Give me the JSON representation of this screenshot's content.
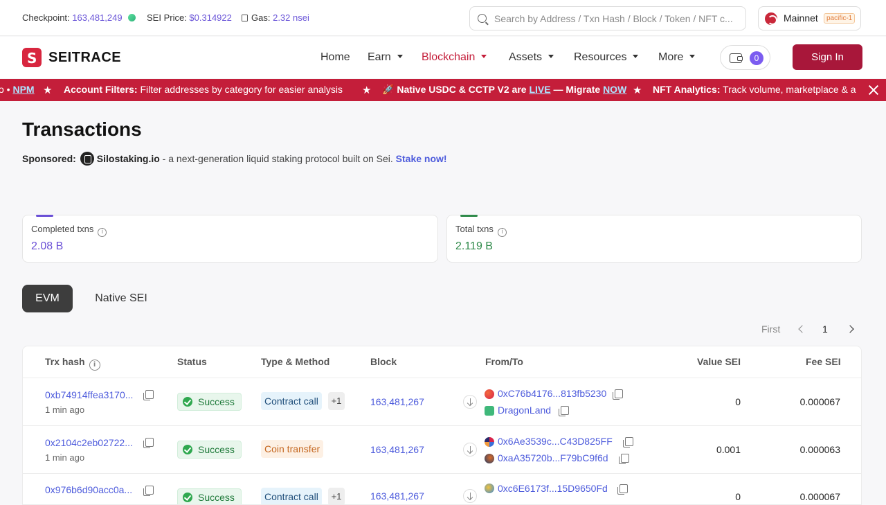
{
  "topbar": {
    "checkpoint_label": "Checkpoint:",
    "checkpoint_value": "163,481,249",
    "price_label": "SEI Price:",
    "price_value": "$0.314922",
    "gas_label": "Gas:",
    "gas_value": "2.32 nsei",
    "search_placeholder": "Search by Address / Txn Hash / Block / Token / NFT c...",
    "network_name": "Mainnet",
    "network_badge": "pacific-1"
  },
  "nav": {
    "brand": "SEITRACE",
    "items": [
      "Home",
      "Earn",
      "Blockchain",
      "Assets",
      "Resources",
      "More"
    ],
    "active_item": "Blockchain",
    "wallet_count": "0",
    "signin_label": "Sign In"
  },
  "banner": {
    "seg1_tail": "o • ",
    "seg1_link": "NPM",
    "seg2_bold": "Account Filters:",
    "seg2_plain": " Filter addresses by category for easier analysis",
    "seg3_icon": "🚀",
    "seg3_a": "Native USDC & CCTP V2 are ",
    "seg3_link1": "LIVE",
    "seg3_b": " — Migrate ",
    "seg3_link2": "NOW",
    "seg4_bold": "NFT Analytics:",
    "seg4_plain": " Track volume, marketplace & a",
    "star": "★"
  },
  "page": {
    "title": "Transactions",
    "sponsored_label": "Sponsored:",
    "sponsor_name": "Silostaking.io",
    "sponsor_text": " - a next-generation liquid staking protocol built on Sei. ",
    "sponsor_cta": "Stake now!"
  },
  "stats": {
    "completed_label": "Completed txns",
    "completed_value": "2.08 B",
    "total_label": "Total txns",
    "total_value": "2.119 B",
    "info_glyph": "i"
  },
  "tabs": [
    "EVM",
    "Native SEI"
  ],
  "pager": {
    "first": "First",
    "page": "1"
  },
  "table": {
    "headers": [
      "Trx hash",
      "Status",
      "Type & Method",
      "Block",
      "From/To",
      "Value SEI",
      "Fee SEI"
    ],
    "rows": [
      {
        "hash": "0xb74914ffea3170...",
        "age": "1 min ago",
        "status": "Success",
        "method": "Contract call",
        "extra": "+1",
        "block": "163,481,267",
        "from": "0xC76b4176...813fb5230",
        "to": "DragonLand",
        "value": "0",
        "fee": "0.000067"
      },
      {
        "hash": "0x2104c2eb02722...",
        "age": "1 min ago",
        "status": "Success",
        "method": "Coin transfer",
        "extra": "",
        "block": "163,481,267",
        "from": "0x6Ae3539c...C43D825FF",
        "to": "0xaA35720b...F79bC9f6d",
        "value": "0.001",
        "fee": "0.000063"
      },
      {
        "hash": "0x976b6d90acc0a...",
        "age": "",
        "status": "Success",
        "method": "Contract call",
        "extra": "+1",
        "block": "163,481,267",
        "from": "0xc6E6173f...15D9650Fd",
        "to": "",
        "value": "0",
        "fee": "0.000067"
      }
    ]
  },
  "colors": {
    "accent": "#c41e3a",
    "link": "#4d5bdc",
    "completed": "#6a4fd6",
    "total": "#2f8a4a"
  }
}
